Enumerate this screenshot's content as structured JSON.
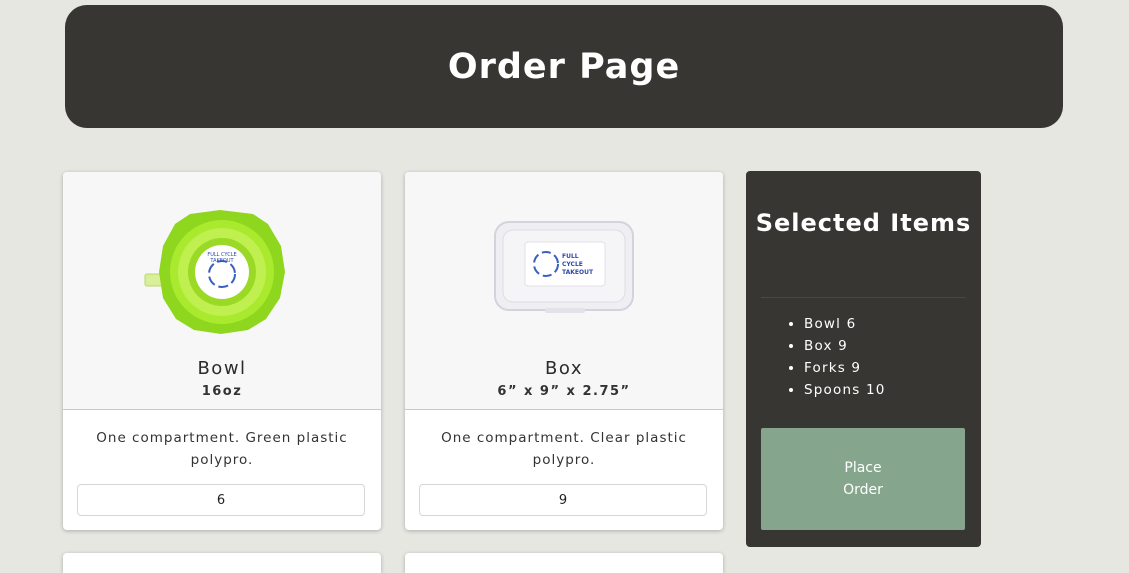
{
  "header": {
    "title": "Order Page"
  },
  "products": [
    {
      "name": "Bowl",
      "size": "16oz",
      "description": "One compartment. Green plastic polypro.",
      "quantity": "6",
      "image_icon": "green-bowl-image",
      "logo_text": "FULL CYCLE TAKEOUT"
    },
    {
      "name": "Box",
      "size": "6” x 9” x 2.75”",
      "description": "One compartment. Clear plastic polypro.",
      "quantity": "9",
      "image_icon": "clear-box-image",
      "logo_text": "FULL CYCLE TAKEOUT"
    }
  ],
  "selected": {
    "title": "Selected Items",
    "items": [
      "Bowl 6",
      "Box 9",
      "Forks 9",
      "Spoons 10"
    ],
    "place_order_label": "Place Order"
  },
  "colors": {
    "header_bg": "#383632",
    "page_bg": "#e7e7e2",
    "accent_button": "#85a68c",
    "bowl_green": "#9be02a"
  }
}
